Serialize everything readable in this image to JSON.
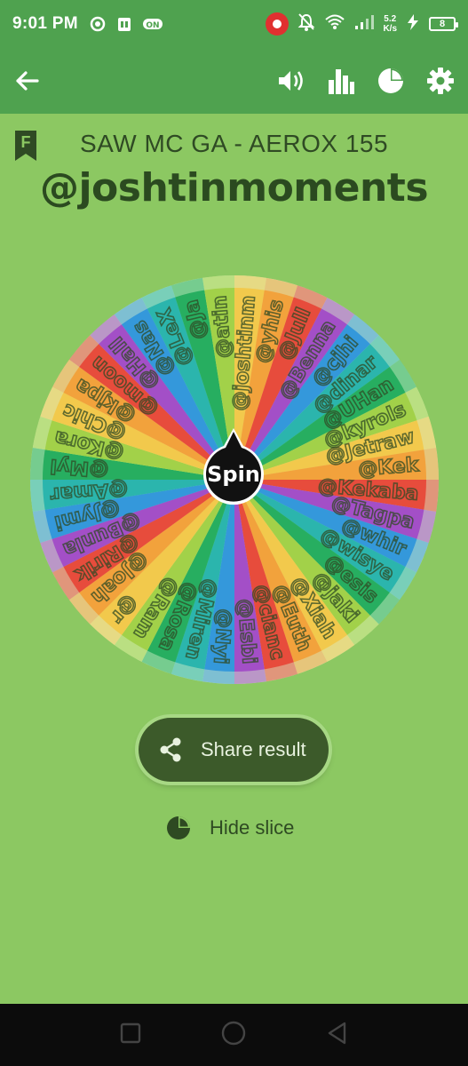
{
  "status_bar": {
    "time": "9:01 PM",
    "network_speed_value": "5.2",
    "network_speed_unit": "K/s",
    "battery_level": "8",
    "icons": [
      "settings-sync-icon",
      "sim-card-icon",
      "on-badge-icon",
      "screen-record-icon",
      "mute-bell-icon",
      "wifi-icon",
      "signal-icon",
      "charging-icon",
      "battery-icon"
    ]
  },
  "app_bar": {
    "back_icon": "arrow-left-icon",
    "action_icons": [
      "volume-icon",
      "bar-chart-icon",
      "pie-chart-icon",
      "settings-icon"
    ]
  },
  "header": {
    "badge_letter": "F",
    "wheel_title": "SAW MC GA - AEROX 155",
    "result": "@joshtinmoments"
  },
  "wheel": {
    "spin_label": "Spin",
    "entries": [
      "@joshtinm",
      "@yhis",
      "@Jull",
      "@Benna",
      "@cjhi",
      "@dinar",
      "@UHan",
      "@kyrols",
      "@Jetraw",
      "@Kek",
      "@Kekaba",
      "@Tagpa",
      "@whir",
      "@wisye",
      "@esis",
      "@jaki",
      "@Xiah",
      "@Euth",
      "@cianc",
      "@Esbi",
      "@Nyi",
      "@Miren",
      "@Rosa",
      "@Ram",
      "@r",
      "@Joah",
      "@Ririk",
      "@Bunla",
      "@Jymi",
      "@Amar",
      "@Myl",
      "@Kora",
      "@Chic",
      "@kjpa",
      "@moon",
      "@Hall",
      "@Nas",
      "@LeX",
      "@Ja",
      "@atin"
    ],
    "colors": [
      "#f2c94c",
      "#f2a23c",
      "#e74c3c",
      "#a34fc7",
      "#3498db",
      "#2bb5ad",
      "#27ae60",
      "#a2d149"
    ]
  },
  "actions": {
    "share_label": "Share result",
    "hide_label": "Hide slice"
  },
  "nav_bar": {
    "icons": [
      "recents-icon",
      "home-icon",
      "back-icon"
    ]
  }
}
